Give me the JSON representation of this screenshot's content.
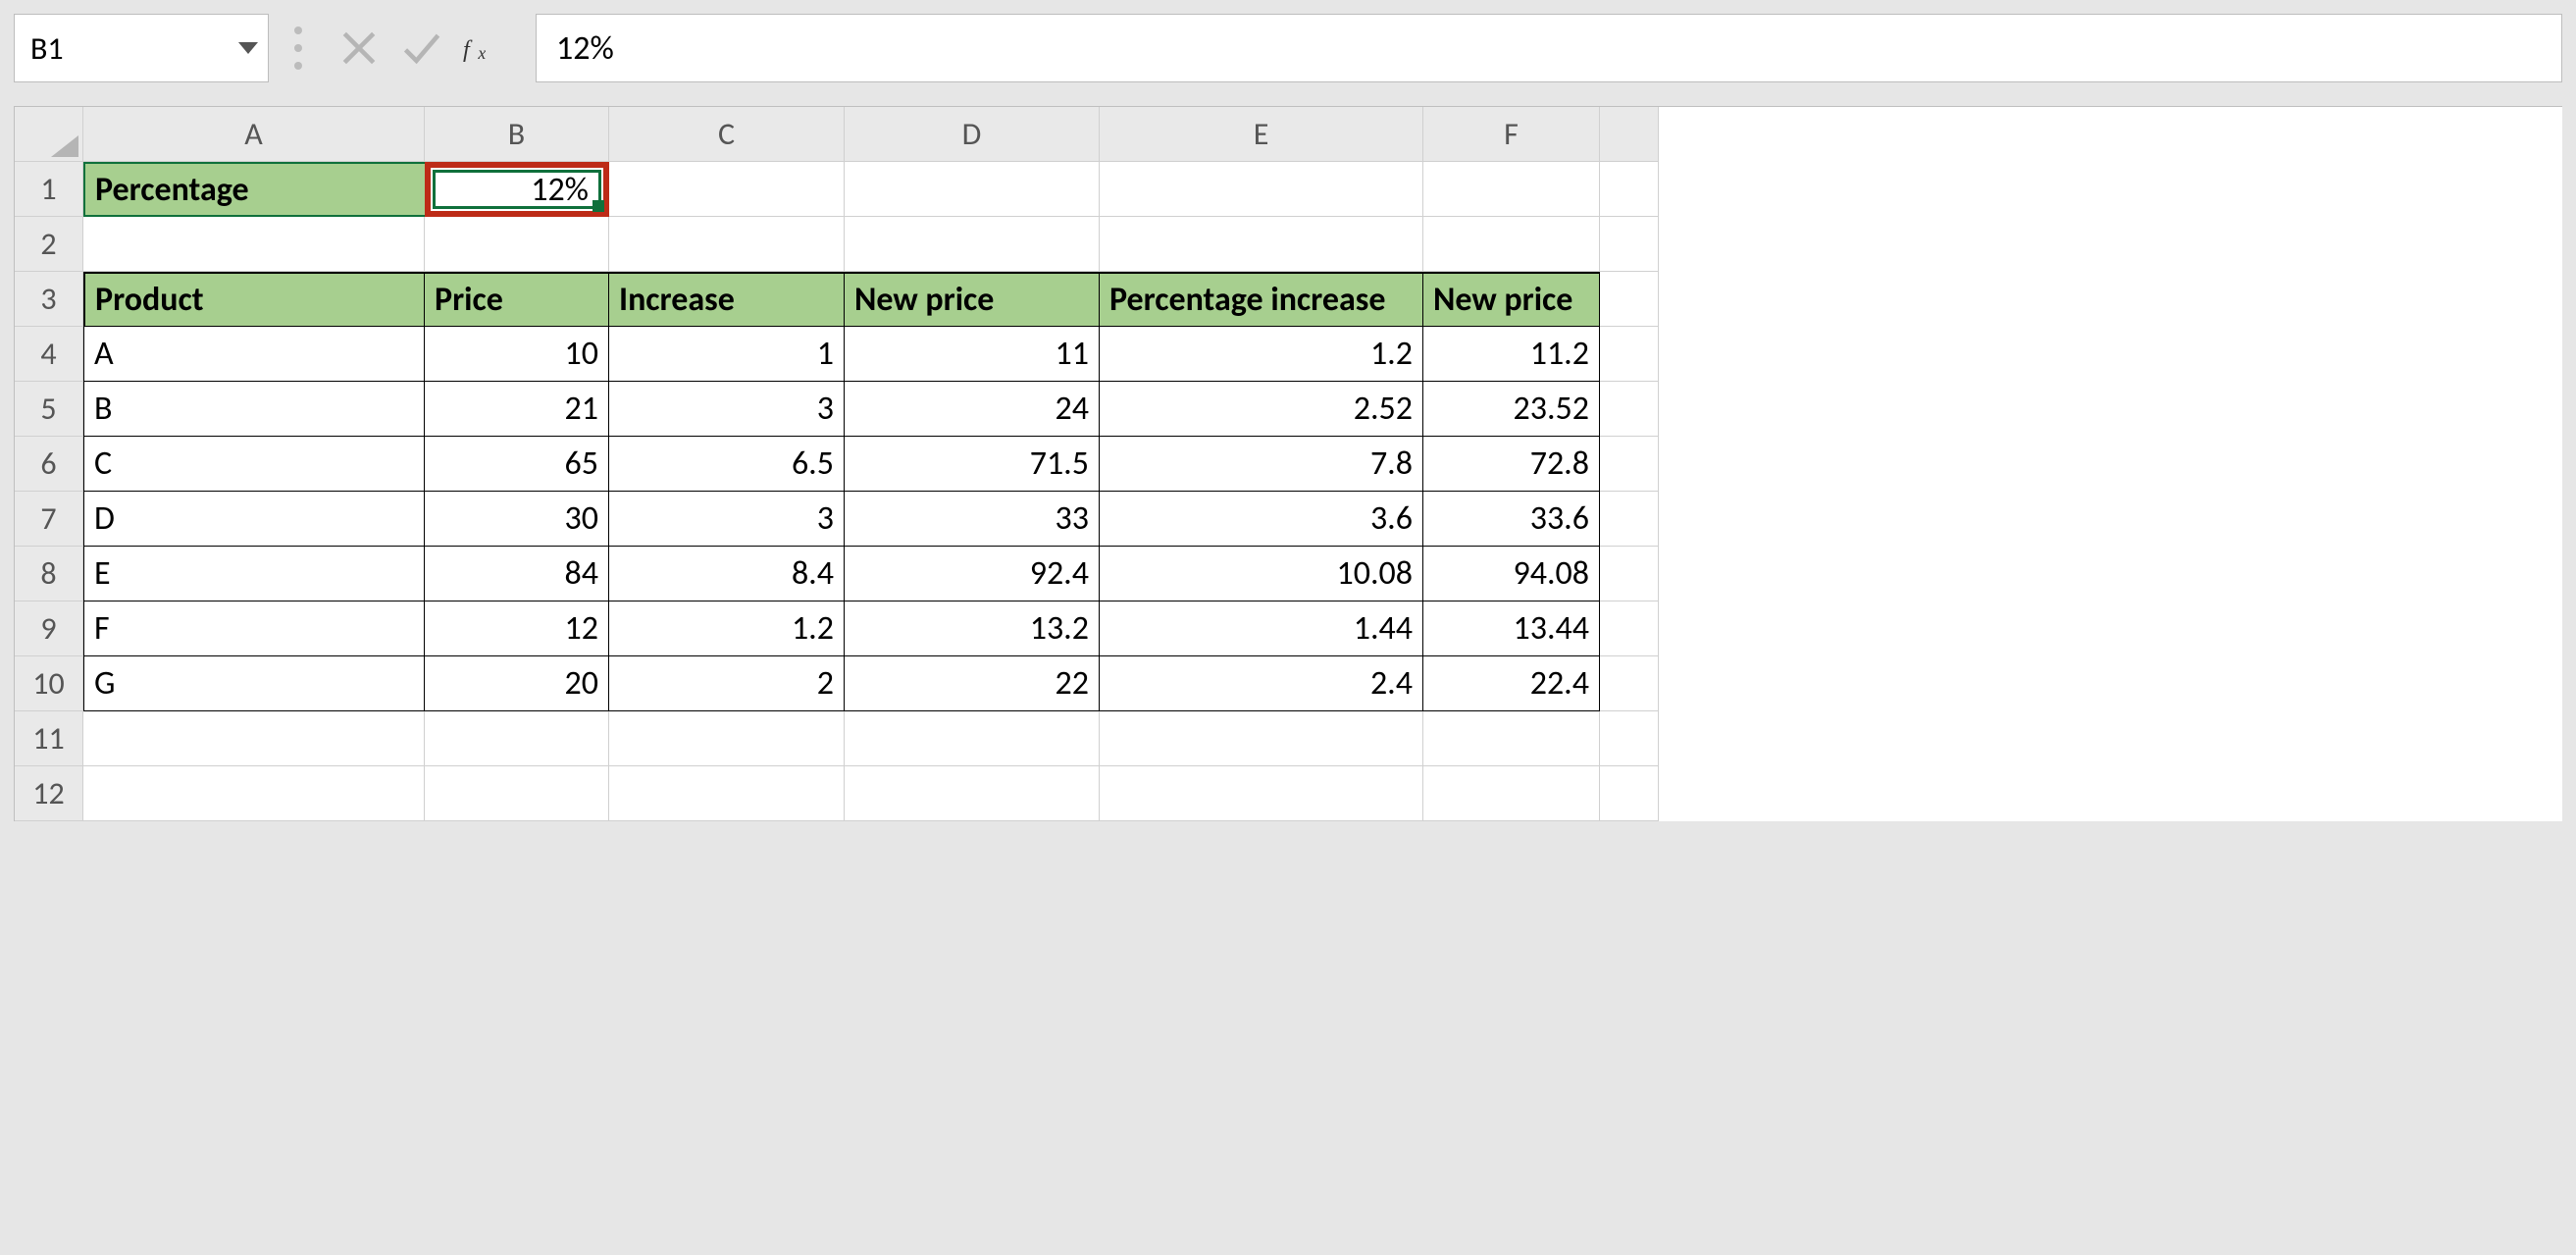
{
  "formula_bar": {
    "name_box": "B1",
    "formula_value": "12%"
  },
  "columns": [
    "A",
    "B",
    "C",
    "D",
    "E",
    "F"
  ],
  "row_numbers": [
    "1",
    "2",
    "3",
    "4",
    "5",
    "6",
    "7",
    "8",
    "9",
    "10",
    "11",
    "12"
  ],
  "a1_label": "Percentage",
  "b1_value": "12%",
  "headers": {
    "A": "Product",
    "B": "Price",
    "C": "Increase",
    "D": "New price",
    "E": "Percentage increase",
    "F": "New price"
  },
  "rows": [
    {
      "product": "A",
      "price": "10",
      "increase": "1",
      "newp": "11",
      "pinc": "1.2",
      "newp2": "11.2"
    },
    {
      "product": "B",
      "price": "21",
      "increase": "3",
      "newp": "24",
      "pinc": "2.52",
      "newp2": "23.52"
    },
    {
      "product": "C",
      "price": "65",
      "increase": "6.5",
      "newp": "71.5",
      "pinc": "7.8",
      "newp2": "72.8"
    },
    {
      "product": "D",
      "price": "30",
      "increase": "3",
      "newp": "33",
      "pinc": "3.6",
      "newp2": "33.6"
    },
    {
      "product": "E",
      "price": "84",
      "increase": "8.4",
      "newp": "92.4",
      "pinc": "10.08",
      "newp2": "94.08"
    },
    {
      "product": "F",
      "price": "12",
      "increase": "1.2",
      "newp": "13.2",
      "pinc": "1.44",
      "newp2": "13.44"
    },
    {
      "product": "G",
      "price": "20",
      "increase": "2",
      "newp": "22",
      "pinc": "2.4",
      "newp2": "22.4"
    }
  ]
}
